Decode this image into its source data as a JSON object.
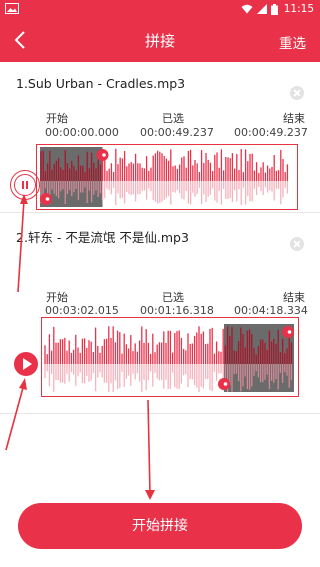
{
  "status_bar": {
    "time": "11:15"
  },
  "header": {
    "title": "拼接",
    "reselect_label": "重选"
  },
  "tracks": [
    {
      "name": "1.Sub Urban - Cradles.mp3",
      "start_label": "开始",
      "start_time": "00:00:00.000",
      "selected_label": "已选",
      "selected_time": "00:00:49.237",
      "end_label": "结束",
      "end_time": "00:00:49.237",
      "state": "playing",
      "selection": [
        0.0,
        0.25
      ]
    },
    {
      "name": "2.轩东 - 不是流氓 不是仙.mp3",
      "start_label": "开始",
      "start_time": "00:03:02.015",
      "selected_label": "已选",
      "selected_time": "00:01:16.318",
      "end_label": "结束",
      "end_time": "00:04:18.334",
      "state": "paused",
      "selection": [
        0.72,
        1.0
      ]
    }
  ],
  "action": {
    "start_label": "开始拼接"
  },
  "colors": {
    "accent": "#e9314a",
    "annotation": "#e53340",
    "wave_top": "#e9314a",
    "wave_bottom": "#f5b3bd",
    "selection_shade": "#6b6b6b"
  }
}
